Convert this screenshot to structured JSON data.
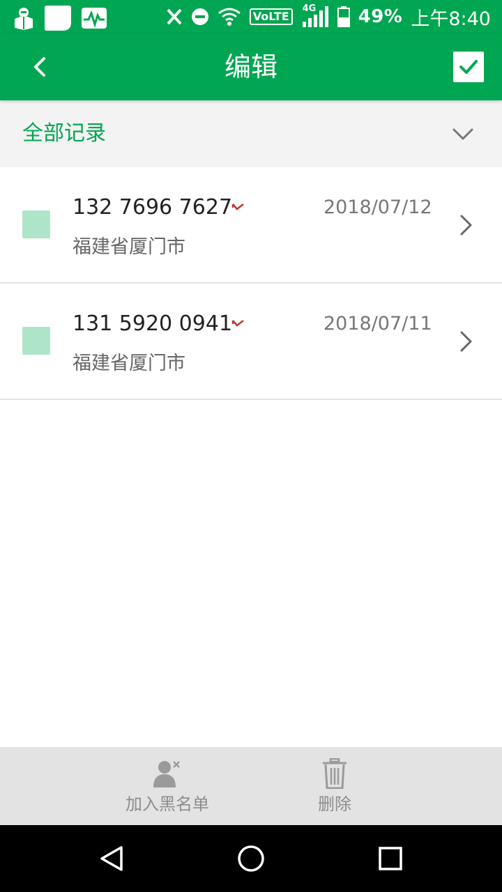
{
  "status_bar": {
    "battery": "49%",
    "time": "上午8:40",
    "network": "4G",
    "volte": "VoLTE",
    "icons": [
      "notification-app-icon",
      "blank-app-icon",
      "activity-monitor-icon",
      "x-icon",
      "do-not-disturb-icon",
      "wifi-icon",
      "volte-icon",
      "signal-4g-icon",
      "battery-icon"
    ]
  },
  "app_bar": {
    "title": "编辑",
    "back_icon": "back-arrow-icon",
    "confirm_icon": "checkmark-icon"
  },
  "filter": {
    "label": "全部记录",
    "icon": "chevron-down-icon"
  },
  "records": [
    {
      "phone": "132 7696 7627",
      "location": "福建省厦门市",
      "date": "2018/07/12",
      "call_icon": "missed-call-icon"
    },
    {
      "phone": "131 5920 0941",
      "location": "福建省厦门市",
      "date": "2018/07/11",
      "call_icon": "missed-call-icon"
    }
  ],
  "bottom_actions": [
    {
      "label": "加入黑名单",
      "icon": "block-user-icon"
    },
    {
      "label": "删除",
      "icon": "trash-icon"
    }
  ],
  "colors": {
    "primary": "#00a651",
    "checkbox": "#aee5c8",
    "missed_call": "#c0392b",
    "bottom_bar": "#e3e3e3"
  }
}
